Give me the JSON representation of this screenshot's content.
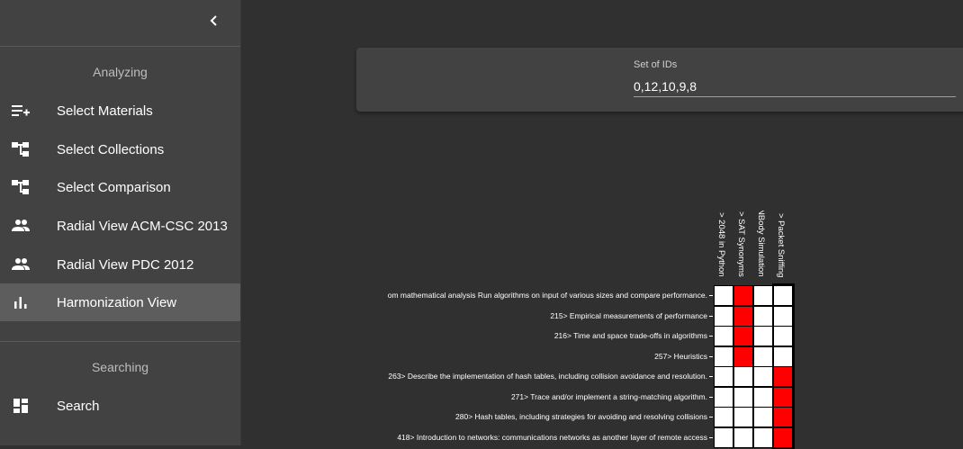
{
  "sidebar": {
    "collapse_icon": "chevron-left-icon",
    "sections": [
      {
        "header": "Analyzing",
        "items": [
          {
            "label": "Select Materials",
            "icon": "playlist-add-icon",
            "active": false
          },
          {
            "label": "Select Collections",
            "icon": "account-tree-icon",
            "active": false
          },
          {
            "label": "Select Comparison",
            "icon": "account-tree-icon",
            "active": false
          },
          {
            "label": "Radial View ACM-CSC 2013",
            "icon": "people-icon",
            "active": false
          },
          {
            "label": "Radial View PDC 2012",
            "icon": "people-icon",
            "active": false
          },
          {
            "label": "Harmonization View",
            "icon": "bar-chart-icon",
            "active": true
          }
        ]
      },
      {
        "header": "Searching",
        "items": [
          {
            "label": "Search",
            "icon": "dashboard-icon",
            "active": false
          }
        ]
      }
    ]
  },
  "ids_field": {
    "label": "Set of IDs",
    "value": "0,12,10,9,8"
  },
  "matrix": {
    "columns": [
      "> 2048 in Python",
      "> SAT Synonyms",
      "NBody Simulation",
      "> Packet Sniffing"
    ],
    "rows": [
      {
        "label": "om mathematical analysis Run algorithms on input of various sizes and compare performance.",
        "cells": [
          0,
          1,
          0,
          0
        ]
      },
      {
        "label": "215> Empirical measurements of performance",
        "cells": [
          0,
          1,
          0,
          0
        ]
      },
      {
        "label": "216> Time and space trade-offs in algorithms",
        "cells": [
          0,
          1,
          0,
          0
        ]
      },
      {
        "label": "257> Heuristics",
        "cells": [
          0,
          1,
          0,
          0
        ]
      },
      {
        "label": "263> Describe the implementation of hash tables, including collision avoidance and resolution.",
        "cells": [
          0,
          0,
          0,
          1
        ]
      },
      {
        "label": "271> Trace and/or implement a string-matching algorithm.",
        "cells": [
          0,
          0,
          0,
          1
        ]
      },
      {
        "label": "280> Hash tables, including strategies for avoiding and resolving collisions",
        "cells": [
          0,
          0,
          0,
          1
        ]
      },
      {
        "label": "418> Introduction to networks: communications networks as another layer of remote access",
        "cells": [
          0,
          0,
          0,
          1
        ]
      }
    ],
    "colors": {
      "match": "#ff0000",
      "empty": "#ffffff"
    }
  }
}
